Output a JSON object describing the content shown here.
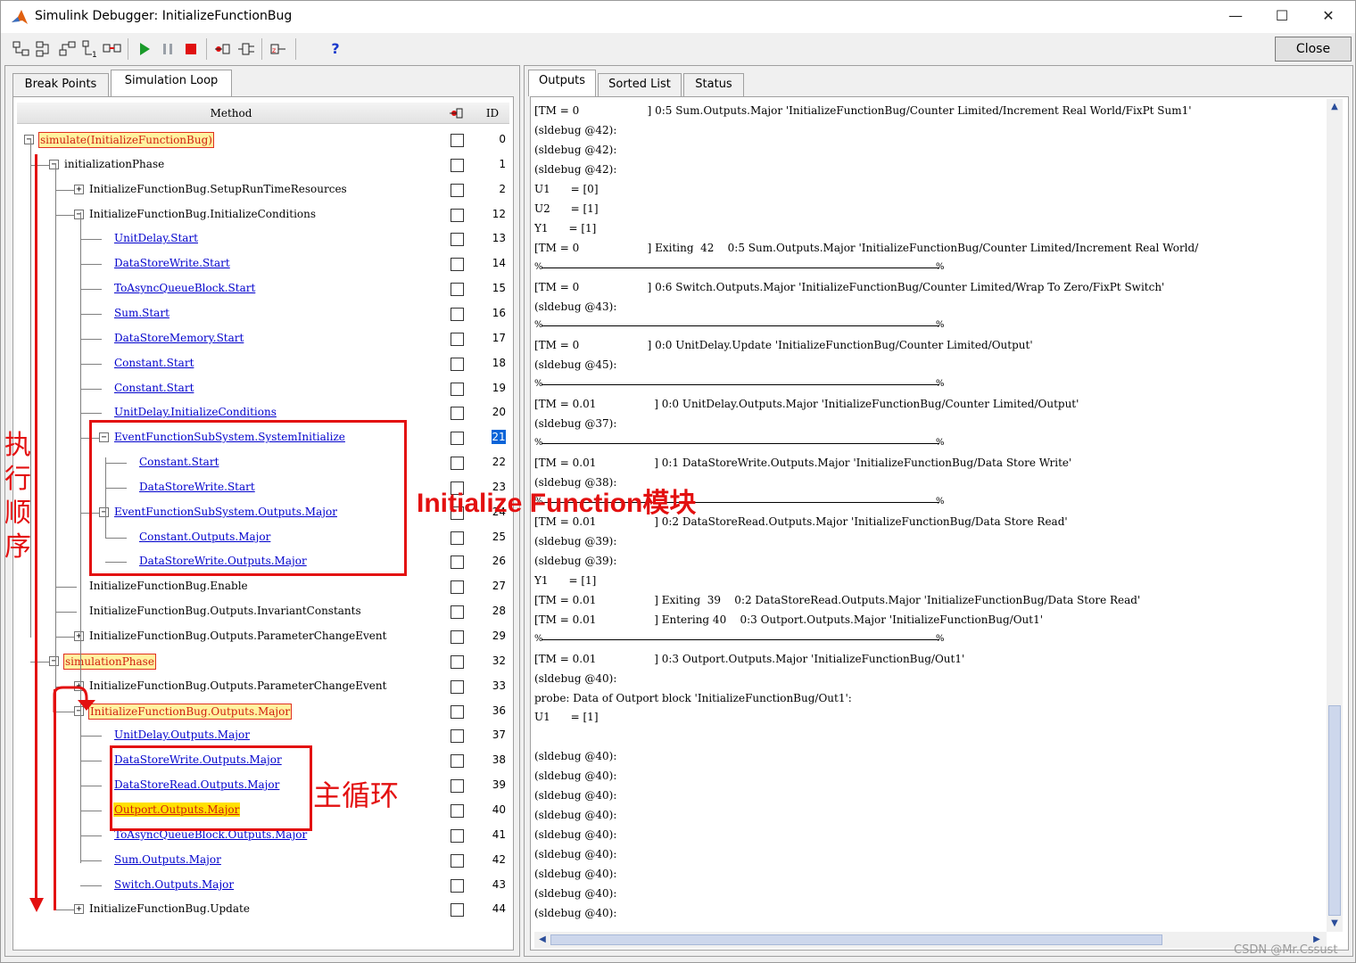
{
  "window": {
    "title": "Simulink Debugger: InitializeFunctionBug",
    "minimize": "—",
    "maximize": "☐",
    "close": "✕"
  },
  "toolbar": {
    "close_label": "Close",
    "help_label": "?",
    "icons": [
      "step-into-icon",
      "step-over-icon",
      "step-out-icon",
      "step-top-icon",
      "step-block-icon",
      "start-icon",
      "pause-icon",
      "stop-icon",
      "breakpoint-icon",
      "display-io-icon",
      "algebraic-loop-icon",
      "help-icon"
    ]
  },
  "left_tabs": [
    "Break Points",
    "Simulation Loop"
  ],
  "right_tabs": [
    "Outputs",
    "Sorted List",
    "Status"
  ],
  "tree_header": {
    "method": "Method",
    "id": "ID"
  },
  "tree": [
    {
      "label": "simulate(InitializeFunctionBug)",
      "id": "0"
    },
    {
      "label": "initializationPhase",
      "id": "1"
    },
    {
      "label": "InitializeFunctionBug.SetupRunTimeResources",
      "id": "2"
    },
    {
      "label": "InitializeFunctionBug.InitializeConditions",
      "id": "12"
    },
    {
      "label": "UnitDelay.Start",
      "id": "13"
    },
    {
      "label": "DataStoreWrite.Start",
      "id": "14"
    },
    {
      "label": "ToAsyncQueueBlock.Start",
      "id": "15"
    },
    {
      "label": "Sum.Start",
      "id": "16"
    },
    {
      "label": "DataStoreMemory.Start",
      "id": "17"
    },
    {
      "label": "Constant.Start",
      "id": "18"
    },
    {
      "label": "Constant.Start",
      "id": "19"
    },
    {
      "label": "UnitDelay.InitializeConditions",
      "id": "20"
    },
    {
      "label": "EventFunctionSubSystem.SystemInitialize",
      "id": "21"
    },
    {
      "label": "Constant.Start",
      "id": "22"
    },
    {
      "label": "DataStoreWrite.Start",
      "id": "23"
    },
    {
      "label": "EventFunctionSubSystem.Outputs.Major",
      "id": "24"
    },
    {
      "label": "Constant.Outputs.Major",
      "id": "25"
    },
    {
      "label": "DataStoreWrite.Outputs.Major",
      "id": "26"
    },
    {
      "label": "InitializeFunctionBug.Enable",
      "id": "27"
    },
    {
      "label": "InitializeFunctionBug.Outputs.InvariantConstants",
      "id": "28"
    },
    {
      "label": "InitializeFunctionBug.Outputs.ParameterChangeEvent",
      "id": "29"
    },
    {
      "label": "simulationPhase",
      "id": "32"
    },
    {
      "label": "InitializeFunctionBug.Outputs.ParameterChangeEvent",
      "id": "33"
    },
    {
      "label": "InitializeFunctionBug.Outputs.Major",
      "id": "36"
    },
    {
      "label": "UnitDelay.Outputs.Major",
      "id": "37"
    },
    {
      "label": "DataStoreWrite.Outputs.Major",
      "id": "38"
    },
    {
      "label": "DataStoreRead.Outputs.Major",
      "id": "39"
    },
    {
      "label": "Outport.Outputs.Major",
      "id": "40"
    },
    {
      "label": "ToAsyncQueueBlock.Outputs.Major",
      "id": "41"
    },
    {
      "label": "Sum.Outputs.Major",
      "id": "42"
    },
    {
      "label": "Switch.Outputs.Major",
      "id": "43"
    },
    {
      "label": "InitializeFunctionBug.Update",
      "id": "44"
    }
  ],
  "annotations": {
    "exec_order": [
      "执",
      "行",
      "顺",
      "序"
    ],
    "init_function_block": "Initialize Function模块",
    "main_loop": "主循环"
  },
  "output_lines": [
    "[TM = 0                    ] 0:5 Sum.Outputs.Major 'InitializeFunctionBug/Counter Limited/Increment Real World/FixPt Sum1'",
    "(sldebug @42):",
    "(sldebug @42):",
    "(sldebug @42):",
    "U1      = [0]",
    "U2      = [1]",
    "Y1      = [1]",
    "[TM = 0                    ] Exiting  42    0:5 Sum.Outputs.Major 'InitializeFunctionBug/Counter Limited/Increment Real World/",
    "%SEP%",
    "[TM = 0                    ] 0:6 Switch.Outputs.Major 'InitializeFunctionBug/Counter Limited/Wrap To Zero/FixPt Switch'",
    "(sldebug @43):",
    "%SEP%",
    "[TM = 0                    ] 0:0 UnitDelay.Update 'InitializeFunctionBug/Counter Limited/Output'",
    "(sldebug @45):",
    "%SEP%",
    "[TM = 0.01                 ] 0:0 UnitDelay.Outputs.Major 'InitializeFunctionBug/Counter Limited/Output'",
    "(sldebug @37):",
    "%SEP%",
    "[TM = 0.01                 ] 0:1 DataStoreWrite.Outputs.Major 'InitializeFunctionBug/Data Store Write'",
    "(sldebug @38):",
    "%SEP%",
    "[TM = 0.01                 ] 0:2 DataStoreRead.Outputs.Major 'InitializeFunctionBug/Data Store Read'",
    "(sldebug @39):",
    "(sldebug @39):",
    "Y1      = [1]",
    "[TM = 0.01                 ] Exiting  39    0:2 DataStoreRead.Outputs.Major 'InitializeFunctionBug/Data Store Read'",
    "[TM = 0.01                 ] Entering 40    0:3 Outport.Outputs.Major 'InitializeFunctionBug/Out1'",
    "%SEP%",
    "[TM = 0.01                 ] 0:3 Outport.Outputs.Major 'InitializeFunctionBug/Out1'",
    "(sldebug @40):",
    "probe: Data of Outport block 'InitializeFunctionBug/Out1':",
    "U1      = [1]",
    "",
    "(sldebug @40):",
    "(sldebug @40):",
    "(sldebug @40):",
    "(sldebug @40):",
    "(sldebug @40):",
    "(sldebug @40):",
    "(sldebug @40):",
    "(sldebug @40):",
    "(sldebug @40):"
  ],
  "separator_marker": "%",
  "watermark": "CSDN @Mr.Cssust",
  "colors": {
    "annotation_red": "#e31010",
    "link_blue": "#0000cc",
    "highlight_yellow": "#ffe000",
    "selection_blue": "#0a64d8"
  }
}
